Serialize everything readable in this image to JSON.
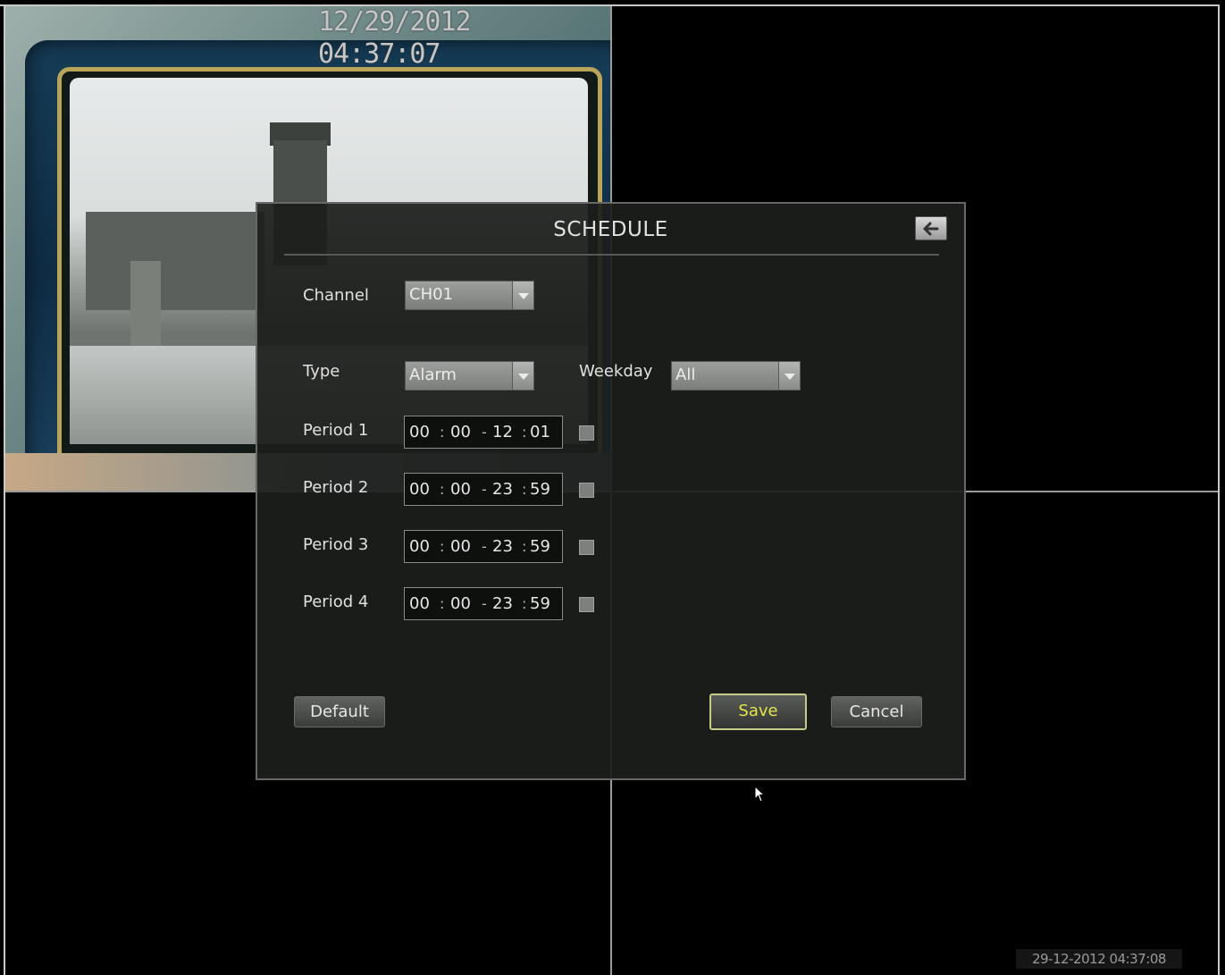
{
  "osd": {
    "camera_timestamp": "12/29/2012 04:37:07",
    "system_clock": "29-12-2012 04:37:08"
  },
  "dialog": {
    "title": "SCHEDULE",
    "back_icon": "back-arrow-icon",
    "channel": {
      "label": "Channel",
      "value": "CH01"
    },
    "type": {
      "label": "Type",
      "value": "Alarm"
    },
    "weekday": {
      "label": "Weekday",
      "value": "All"
    },
    "periods": [
      {
        "label": "Period 1",
        "start_h": "00",
        "start_m": "00",
        "end_h": "12",
        "end_m": "01",
        "enabled": false
      },
      {
        "label": "Period 2",
        "start_h": "00",
        "start_m": "00",
        "end_h": "23",
        "end_m": "59",
        "enabled": false
      },
      {
        "label": "Period 3",
        "start_h": "00",
        "start_m": "00",
        "end_h": "23",
        "end_m": "59",
        "enabled": false
      },
      {
        "label": "Period 4",
        "start_h": "00",
        "start_m": "00",
        "end_h": "23",
        "end_m": "59",
        "enabled": false
      }
    ],
    "buttons": {
      "default": "Default",
      "save": "Save",
      "cancel": "Cancel"
    }
  },
  "colors": {
    "save_text": "#e3e34a",
    "dialog_bg": "#1c1e1c",
    "select_bg": "#8c8e8c"
  }
}
